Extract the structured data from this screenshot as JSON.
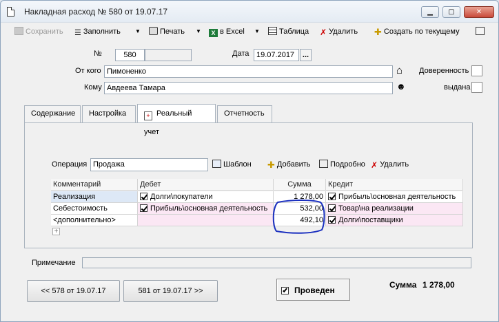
{
  "window": {
    "title": "Накладная расход № 580 от 19.07.17"
  },
  "toolbar": {
    "save": "Сохранить",
    "fill": "Заполнить",
    "print": "Печать",
    "excel": "в Excel",
    "table": "Таблица",
    "delete": "Удалить",
    "create_by_current": "Создать по текущему"
  },
  "header": {
    "number_label": "№",
    "number_value": "580",
    "date_label": "Дата",
    "date_value": "19.07.2017",
    "date_button": "...",
    "from_label": "От кого",
    "from_value": "Пимоненко",
    "to_label": "Кому",
    "to_value": "Авдеева Тамара",
    "proxy_label": "Доверенность",
    "issued_label": "выдана"
  },
  "tabs": [
    {
      "label": "Содержание"
    },
    {
      "label": "Настройка"
    },
    {
      "label": "Реальный учет"
    },
    {
      "label": "Отчетность"
    }
  ],
  "operation": {
    "label": "Операция",
    "value": "Продажа",
    "template": "Шаблон",
    "add": "Добавить",
    "details": "Подробно",
    "delete": "Удалить"
  },
  "grid": {
    "columns": [
      "Комментарий",
      "Дебет",
      "Сумма",
      "Кредит"
    ],
    "rows": [
      {
        "comment": "Реализация",
        "debit": "Долги\\покупатели",
        "sum": "1 278,00",
        "credit": "Прибыль\\основная деятельность"
      },
      {
        "comment": "Себестоимость",
        "debit": "Прибыль\\основная деятельность",
        "sum": "532,00",
        "credit": "Товар\\на реализации"
      },
      {
        "comment": "<дополнительно>",
        "debit": "",
        "sum": "492,10",
        "credit": "Долги\\поставщики"
      }
    ],
    "add_row": "+"
  },
  "note": {
    "label": "Примечание",
    "value": ""
  },
  "nav": {
    "prev": "<< 578 от 19.07.17",
    "next": "581 от 19.07.17 >>"
  },
  "posted": {
    "label": "Проведен"
  },
  "total": {
    "label": "Сумма",
    "value": "1 278,00"
  },
  "colors": {
    "selected_row": "#dde8f6",
    "credit_cell": "#fbe7f4",
    "annotation": "#1a2fbf"
  }
}
